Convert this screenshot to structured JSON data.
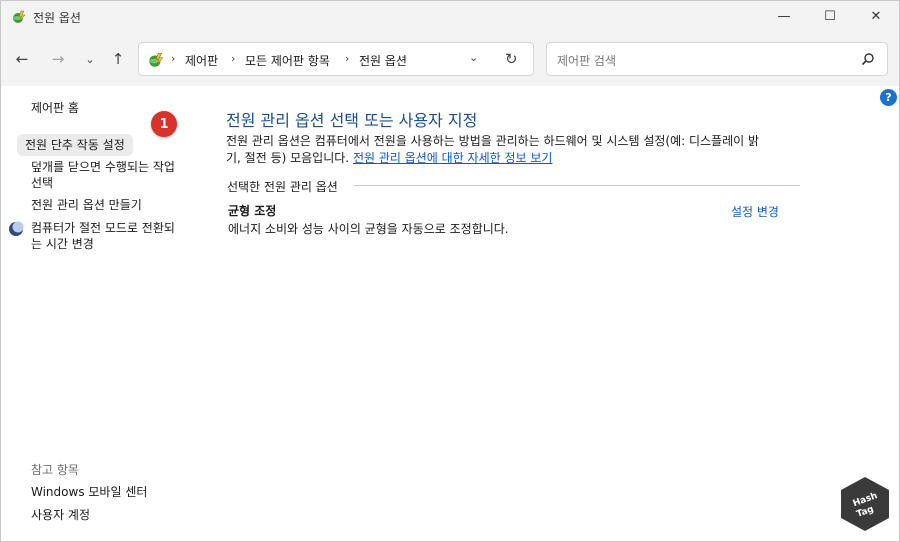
{
  "window": {
    "title": "전원 옵션",
    "minimize_glyph": "—",
    "maximize_glyph": "☐",
    "close_glyph": "✕"
  },
  "nav": {
    "back_glyph": "←",
    "forward_glyph": "→",
    "recent_glyph": "⌄",
    "up_glyph": "↑",
    "crumbs": [
      "제어판",
      "모든 제어판 항목",
      "전원 옵션"
    ],
    "crumb_sep": "›",
    "dropdown_glyph": "⌄",
    "refresh_glyph": "↻"
  },
  "search": {
    "placeholder": "제어판 검색"
  },
  "help": {
    "glyph": "?"
  },
  "sidebar": {
    "home": "제어판 홈",
    "items": [
      "전원 단추 작동 설정",
      "덮개를 닫으면 수행되는 작업",
      "선택",
      "전원 관리 옵션 만들기",
      "컴퓨터가 절전 모드로 전환되",
      "는 시간 변경"
    ],
    "see_also_label": "참고 항목",
    "see_also": [
      "Windows 모바일 센터",
      "사용자 계정"
    ]
  },
  "marker": {
    "number": "1"
  },
  "main": {
    "title": "전원 관리 옵션 선택 또는 사용자 지정",
    "desc_line1": "전원 관리 옵션은 컴퓨터에서 전원을 사용하는 방법을 관리하는 하드웨어 및 시스템 설정(예: 디스플레이 밝",
    "desc_line2_prefix": "기, 절전 등) 모음입니다. ",
    "desc_link": "전원 관리 옵션에 대한 자세한 정보 보기",
    "group_label": "선택한 전원 관리 옵션",
    "plan_name": "균형 조정",
    "plan_desc": "에너지 소비와 성능 사이의 균형을 자동으로 조정합니다.",
    "plan_link": "설정 변경"
  },
  "watermark": {
    "line1": "Hash",
    "line2": "Tag"
  },
  "colors": {
    "accent_link": "#0b5cc7",
    "title_blue": "#1a4f8f",
    "marker_red": "#d8332a"
  }
}
